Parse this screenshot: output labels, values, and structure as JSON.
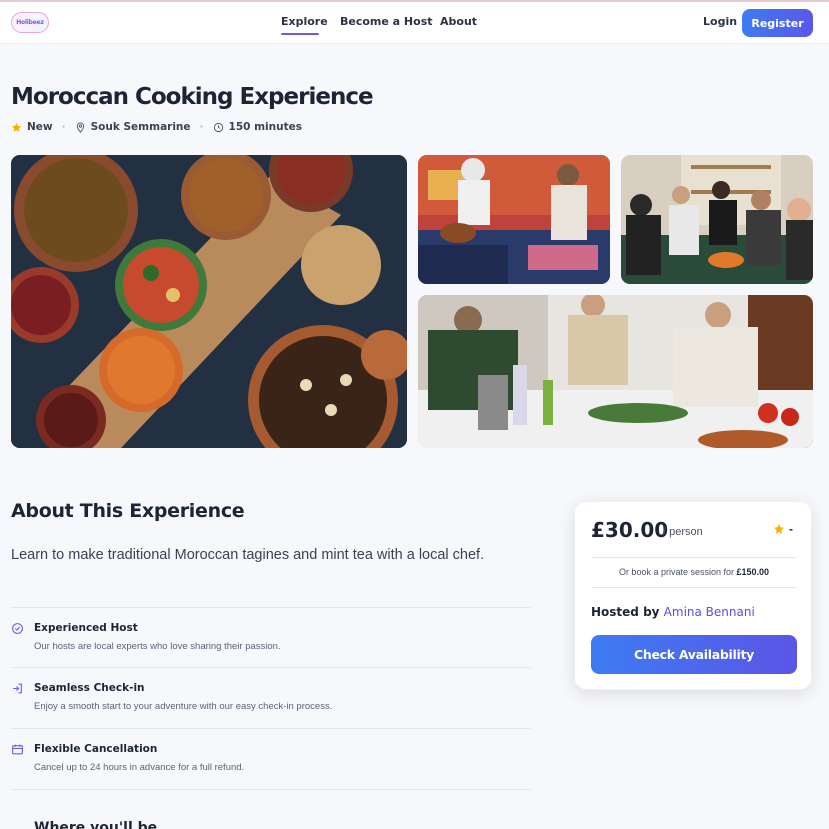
{
  "nav": {
    "logo_text": "Holibeez",
    "links": [
      "Explore",
      "Become a Host",
      "About"
    ],
    "active": "Explore",
    "login_label": "Login",
    "register_label": "Register"
  },
  "experience": {
    "title": "Moroccan Cooking Experience",
    "rating_label": "New",
    "location": "Souk Semmarine",
    "duration": "150 minutes"
  },
  "gallery": {
    "images": [
      "moroccan-dishes-spread",
      "cooking-class-host-and-chef",
      "group-cooking-class",
      "women-preparing-ingredients"
    ]
  },
  "about": {
    "heading": "About This Experience",
    "description": "Learn to make traditional Moroccan tagines and mint tea with a local chef.",
    "features": [
      {
        "title": "Experienced Host",
        "desc": "Our hosts are local experts who love sharing their passion.",
        "icon": "check-circle-icon"
      },
      {
        "title": "Seamless Check-in",
        "desc": "Enjoy a smooth start to your adventure with our easy check-in process.",
        "icon": "login-icon"
      },
      {
        "title": "Flexible Cancellation",
        "desc": "Cancel up to 24 hours in advance for a full refund.",
        "icon": "calendar-icon"
      }
    ],
    "next_heading": "Where you'll be"
  },
  "booking": {
    "price": "£30.00",
    "per": "/ person",
    "rating": "-",
    "private_prefix": "Or book a private session for",
    "private_price": "£150.00",
    "hosted_prefix": "Hosted by",
    "host_name": "Amina Bennani",
    "cta": "Check Availability"
  },
  "colors": {
    "accent": "#5a57e8",
    "accent_start": "#3d7cf3",
    "star": "#f5b301",
    "text": "#1c2436"
  }
}
